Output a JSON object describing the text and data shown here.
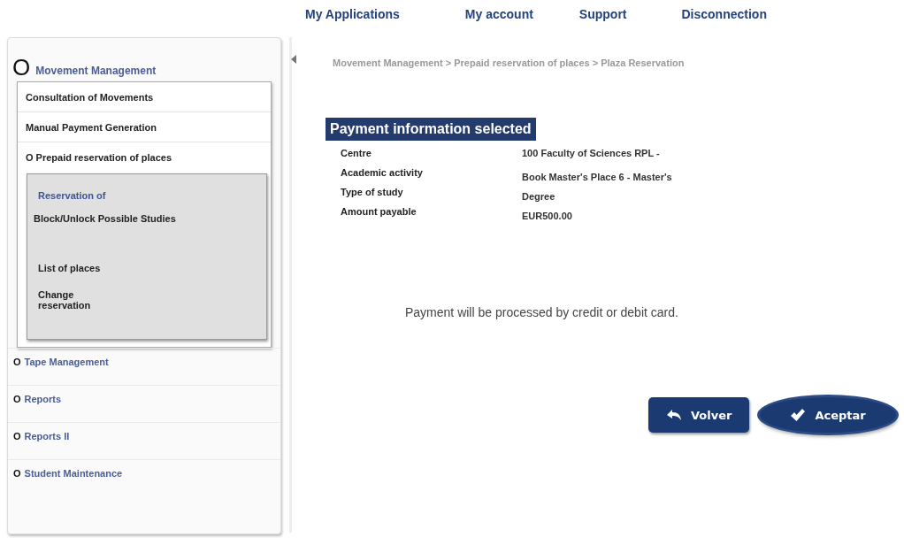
{
  "top_nav": [
    {
      "label": "My Applications"
    },
    {
      "label": "My account"
    },
    {
      "label": "Support"
    },
    {
      "label": "Disconnection"
    }
  ],
  "sidebar": {
    "items": [
      {
        "marker": "O",
        "label": "Movement Management",
        "expanded": true,
        "children": [
          {
            "label": "Consultation of Movements"
          },
          {
            "label": "Manual Payment Generation"
          },
          {
            "marker": "O",
            "label": "Prepaid reservation of places",
            "expanded": true,
            "children": [
              {
                "label": "Reservation of",
                "selected": true
              },
              {
                "label": "Block/Unlock Possible Studies",
                "selected": false
              },
              {
                "label": "List of places",
                "selected": false
              },
              {
                "label": "Change reservation",
                "selected": false
              }
            ]
          }
        ]
      },
      {
        "marker": "O",
        "label": "Tape Management"
      },
      {
        "marker": "O",
        "label": "Reports"
      },
      {
        "marker": "O",
        "label": "Reports II"
      },
      {
        "marker": "O",
        "label": "Student Maintenance"
      }
    ]
  },
  "breadcrumb": "Movement Management > Prepaid reservation of places > Plaza Reservation",
  "section_title": "Payment information selected",
  "details": [
    {
      "label": "Centre",
      "value": "100 Faculty of Sciences RPL -"
    },
    {
      "label": "Academic activity",
      "value": "**Book** Master's Place 6 - Master's"
    },
    {
      "label": "Type of study",
      "value": "Degree"
    },
    {
      "label": "Amount payable",
      "value": "**EUR**500.00"
    }
  ],
  "notice": "Payment will be processed by credit or debit card.",
  "buttons": [
    {
      "label": "Volver",
      "kind": "back",
      "selected": false
    },
    {
      "label": "Aceptar",
      "kind": "accept",
      "selected": true
    }
  ]
}
